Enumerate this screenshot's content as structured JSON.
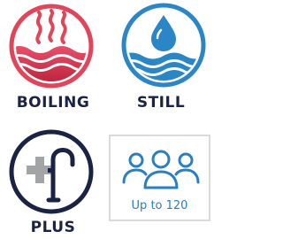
{
  "features": {
    "boiling": {
      "label": "BOILING",
      "icon": "boiling-water-icon",
      "color": "#e0455a"
    },
    "still": {
      "label": "STILL",
      "icon": "water-drop-icon",
      "color": "#2b86c6"
    },
    "plus": {
      "label": "PLUS",
      "icon": "tap-plus-icon",
      "color": "#1b2345",
      "accent": "#a3a4a6"
    },
    "capacity": {
      "text": "Up to 120",
      "icon": "people-group-icon",
      "color": "#2a7fc1"
    }
  }
}
